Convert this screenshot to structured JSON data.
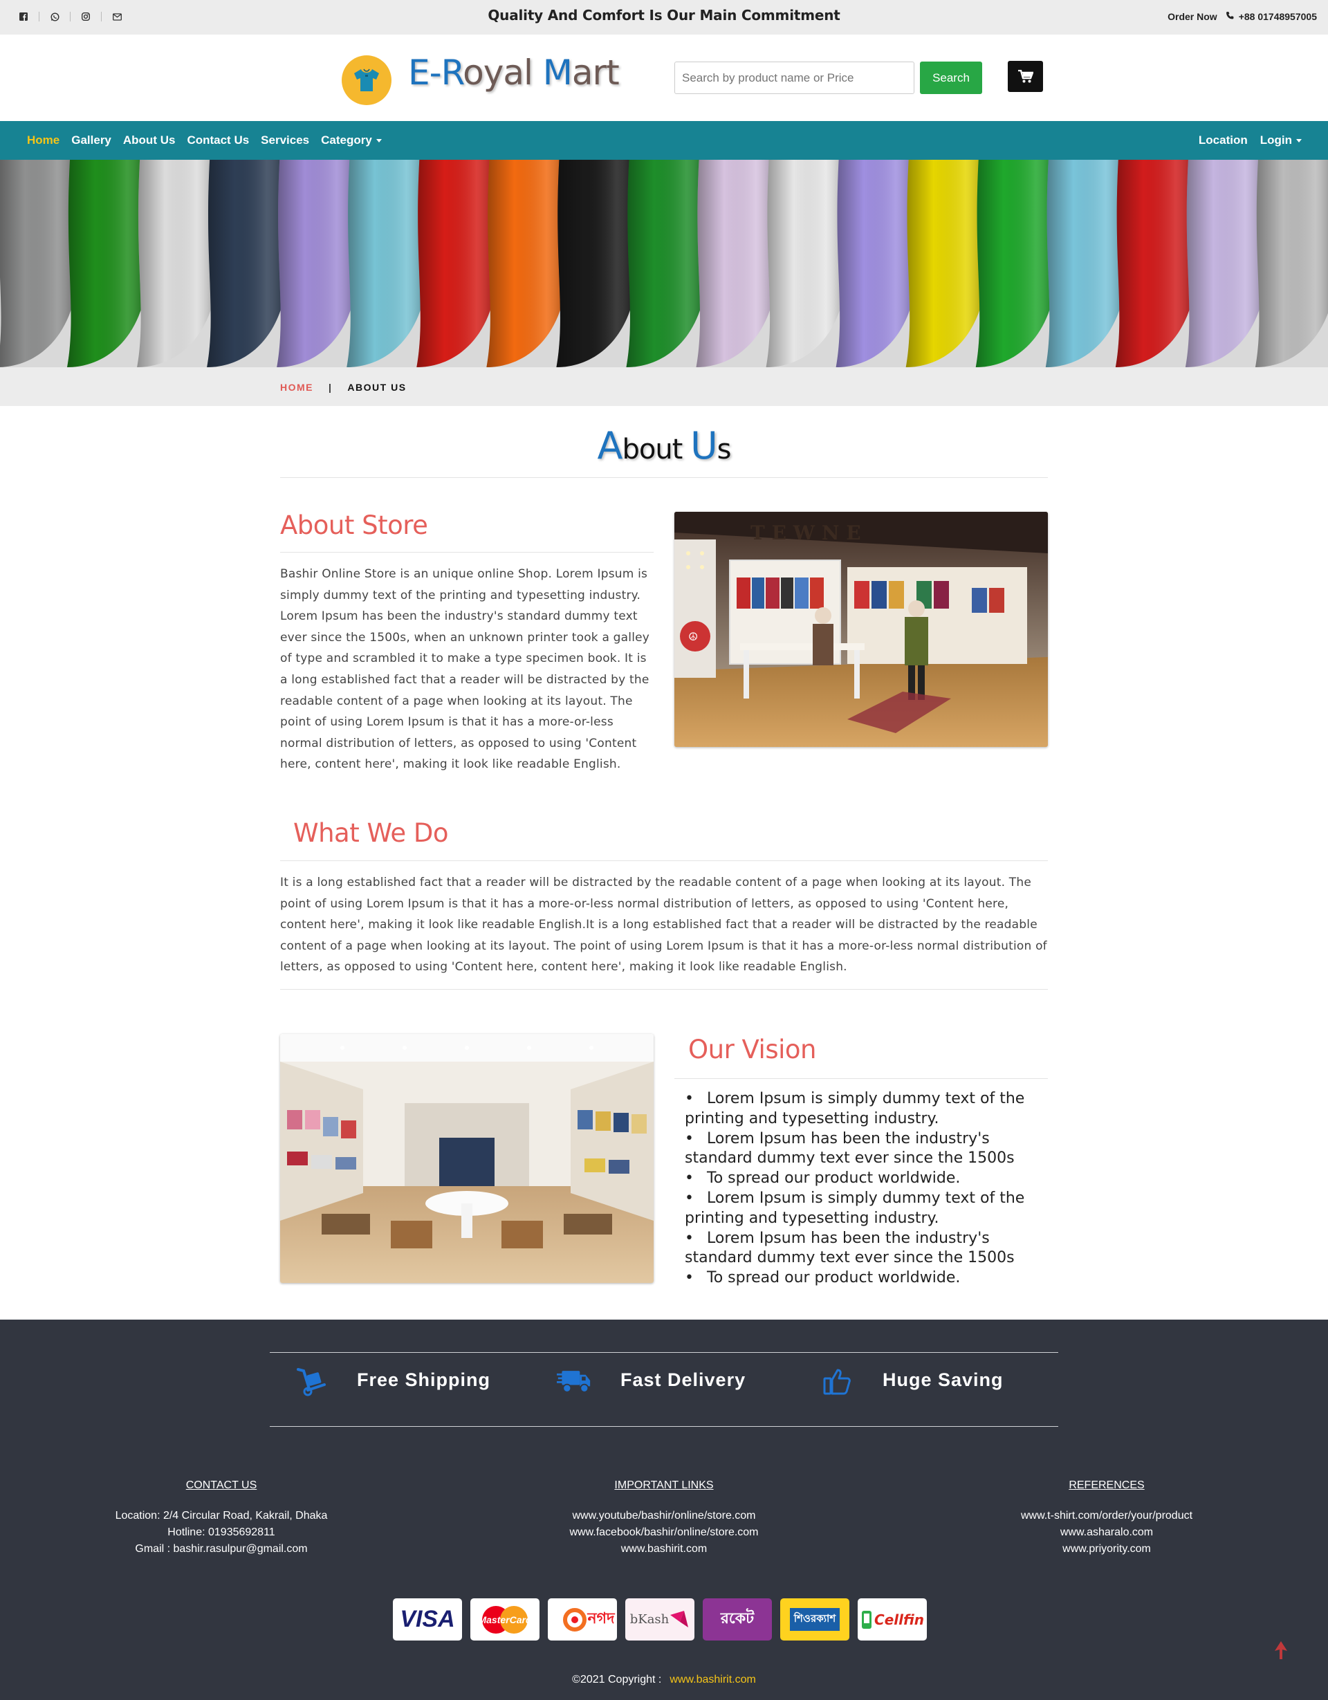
{
  "topbar": {
    "tagline": "Quality And Comfort Is Our Main Commitment",
    "order_label": "Order Now",
    "phone": "+88 01748957005",
    "social_icons": [
      "facebook-icon",
      "whatsapp-icon",
      "instagram-icon",
      "email-icon"
    ]
  },
  "header": {
    "brand_parts": [
      "E-",
      "R",
      "oyal ",
      "M",
      "art"
    ],
    "search_placeholder": "Search by product name or Price",
    "search_button": "Search"
  },
  "nav": {
    "items": [
      "Home",
      "Gallery",
      "About Us",
      "Contact Us",
      "Services",
      "Category"
    ],
    "right_items": [
      "Location",
      "Login"
    ],
    "active_color": "#f5c518",
    "bar_color": "#178393"
  },
  "breadcrumb": {
    "home": "HOME",
    "separator": "|",
    "current": "ABOUT US"
  },
  "page_title": {
    "first_letter": "A",
    "rest1": "bout ",
    "second_letter": "U",
    "rest2": "s"
  },
  "about_store": {
    "title": "About Store",
    "text": "Bashir Online Store is an unique online Shop. Lorem Ipsum is simply dummy text of the printing and typesetting industry. Lorem Ipsum has been the industry's standard dummy text ever since the 1500s, when an unknown printer took a galley of type and scrambled it to make a type specimen book. It is a long established fact that a reader will be distracted by the readable content of a page when looking at its layout. The point of using Lorem Ipsum is that it has a more-or-less normal distribution of letters, as opposed to using 'Content here, content here', making it look like readable English."
  },
  "what_we_do": {
    "title": "What We Do",
    "text": "It is a long established fact that a reader will be distracted by the readable content of a page when looking at its layout. The point of using Lorem Ipsum is that it has a more-or-less normal distribution of letters, as opposed to using 'Content here, content here', making it look like readable English.It is a long established fact that a reader will be distracted by the readable content of a page when looking at its layout. The point of using Lorem Ipsum is that it has a more-or-less normal distribution of letters, as opposed to using 'Content here, content here', making it look like readable English."
  },
  "our_vision": {
    "title": "Our Vision",
    "items": [
      "Lorem Ipsum is simply dummy text of the printing and typesetting industry.",
      "Lorem Ipsum has been the industry's standard dummy text ever since the 1500s",
      "To spread our product worldwide.",
      "Lorem Ipsum is simply dummy text of the printing and typesetting industry.",
      "Lorem Ipsum has been the industry's standard dummy text ever since the 1500s",
      "To spread our product worldwide."
    ]
  },
  "features": [
    {
      "label": "Free Shipping",
      "icon": "dolly-icon"
    },
    {
      "label": "Fast Delivery",
      "icon": "truck-icon"
    },
    {
      "label": "Huge Saving",
      "icon": "thumbs-up-icon"
    }
  ],
  "footer": {
    "contact": {
      "heading": "CONTACT US",
      "lines": [
        "Location: 2/4 Circular Road, Kakrail, Dhaka",
        "Hotline: 01935692811",
        "Gmail : bashir.rasulpur@gmail.com"
      ]
    },
    "links": {
      "heading": "IMPORTANT LINKS",
      "lines": [
        "www.youtube/bashir/online/store.com",
        "www.facebook/bashir/online/store.com",
        "www.bashirit.com"
      ]
    },
    "references": {
      "heading": "REFERENCES",
      "lines": [
        "www.t-shirt.com/order/your/product",
        "www.asharalo.com",
        "www.priyority.com"
      ]
    },
    "payment_methods": [
      "VISA",
      "MasterCard",
      "নগদ",
      "bKash",
      "রকেট",
      "শিওরক্যাশ",
      "Cellfin"
    ],
    "copyright": "©2021 Copyright :",
    "copyright_link": "www.bashirit.com"
  },
  "colors": {
    "accent_red": "#e55f5a",
    "brand_blue": "#1e73be",
    "footer_bg": "#323640",
    "search_green": "#28a745"
  }
}
